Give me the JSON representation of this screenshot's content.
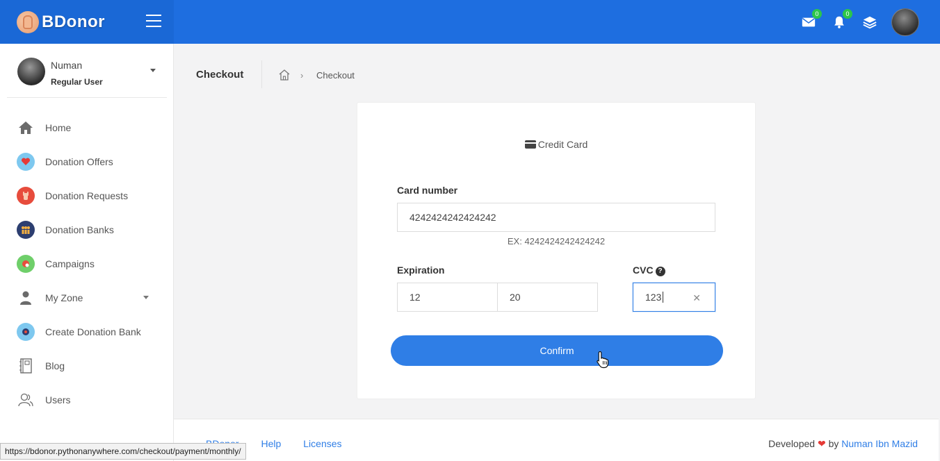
{
  "app": {
    "brand": "BDonor",
    "header": {
      "mail_badge": "0",
      "notif_badge": "0"
    }
  },
  "sidebar": {
    "user": {
      "name": "Numan",
      "role": "Regular User"
    },
    "items": [
      {
        "label": "Home",
        "icon": "home-icon"
      },
      {
        "label": "Donation Offers",
        "icon": "heart-hand-icon"
      },
      {
        "label": "Donation Requests",
        "icon": "raised-hand-icon"
      },
      {
        "label": "Donation Banks",
        "icon": "people-group-icon"
      },
      {
        "label": "Campaigns",
        "icon": "campaign-icon"
      },
      {
        "label": "My Zone",
        "icon": "user-icon"
      },
      {
        "label": "Create Donation Bank",
        "icon": "bank-globe-icon"
      },
      {
        "label": "Blog",
        "icon": "notebook-icon"
      },
      {
        "label": "Users",
        "icon": "users-icon"
      }
    ]
  },
  "page": {
    "title": "Checkout",
    "breadcrumb_current": "Checkout"
  },
  "payment": {
    "heading": "Credit Card",
    "card_number_label": "Card number",
    "card_number_value": "4242424242424242",
    "card_number_hint": "EX: 4242424242424242",
    "expiration_label": "Expiration",
    "exp_month": "12",
    "exp_year": "20",
    "cvc_label": "CVC",
    "cvc_help": "?",
    "cvc_value": "123",
    "confirm_label": "Confirm"
  },
  "footer": {
    "links": [
      "BDonor",
      "Help",
      "Licenses"
    ],
    "credit_prefix": "Developed",
    "credit_by": "by",
    "author": "Numan Ibn Mazid"
  },
  "status_bar": {
    "url": "https://bdonor.pythonanywhere.com/checkout/payment/monthly/"
  },
  "colors": {
    "primary": "#1e6ee0",
    "accent": "#2f7ee6",
    "badge": "#2cc64a",
    "heart": "#e53935"
  }
}
